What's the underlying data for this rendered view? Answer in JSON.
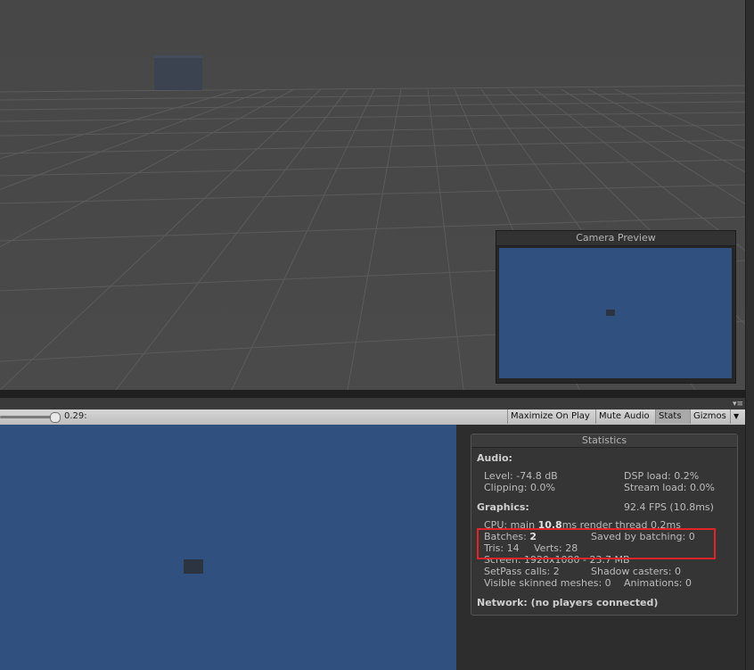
{
  "camera_preview": {
    "title": "Camera Preview"
  },
  "game_toolbar": {
    "scale_value": "0.29:",
    "buttons": [
      {
        "label": "Maximize On Play",
        "active": false
      },
      {
        "label": "Mute Audio",
        "active": false
      },
      {
        "label": "Stats",
        "active": true
      },
      {
        "label": "Gizmos",
        "active": false
      }
    ]
  },
  "stats": {
    "title": "Statistics",
    "audio_label": "Audio:",
    "level": "Level: -74.8 dB",
    "clipping": "Clipping: 0.0%",
    "dsp_load": "DSP load: 0.2%",
    "stream_load": "Stream load: 0.0%",
    "graphics_label": "Graphics:",
    "fps": "92.4 FPS (10.8ms)",
    "cpu_prefix": "CPU: main ",
    "cpu_main": "10.8",
    "cpu_suffix": "ms  render thread 0.2ms",
    "batches_prefix": "Batches: ",
    "batches_value": "2",
    "saved_by_batching": "Saved by batching: 0",
    "tris": "Tris: 14",
    "verts": "Verts: 28",
    "screen": "Screen: 1920x1080 - 23.7 MB",
    "setpass": "SetPass calls: 2",
    "shadow_casters": "Shadow casters: 0",
    "skinned": "Visible skinned meshes: 0",
    "animations": "Animations: 0",
    "network": "Network: (no players connected)"
  }
}
